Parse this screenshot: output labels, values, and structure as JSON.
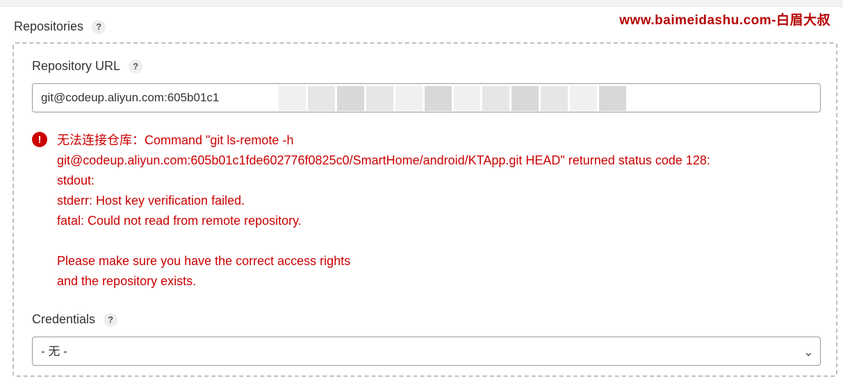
{
  "watermark": "www.baimeidashu.com-白眉大叔",
  "repositories": {
    "label": "Repositories",
    "help": "?"
  },
  "repositoryUrl": {
    "label": "Repository URL",
    "help": "?",
    "value": "git@codeup.aliyun.com:605b01c1"
  },
  "error": {
    "icon": "!",
    "message": "无法连接仓库：Command \"git ls-remote -h\ngit@codeup.aliyun.com:605b01c1fde602776f0825c0/SmartHome/android/KTApp.git HEAD\" returned status code 128:\nstdout:\nstderr: Host key verification failed.\nfatal: Could not read from remote repository.\n\nPlease make sure you have the correct access rights\nand the repository exists."
  },
  "credentials": {
    "label": "Credentials",
    "help": "?",
    "selected": "- 无 -"
  }
}
